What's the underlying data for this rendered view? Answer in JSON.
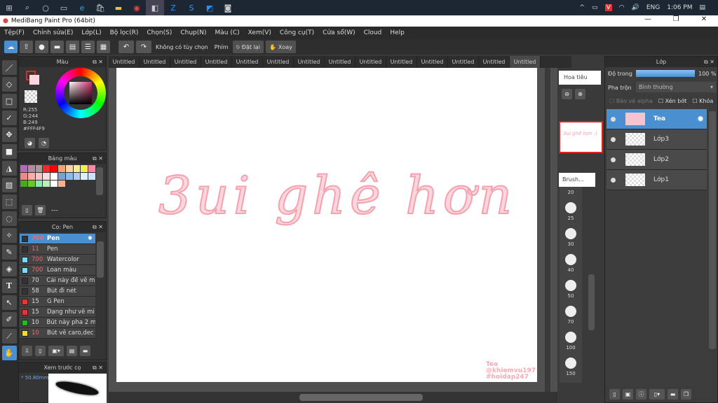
{
  "taskbar": {
    "icons": [
      "windows-icon",
      "search-icon",
      "cortana-icon",
      "task-view-icon",
      "edge-icon",
      "store-icon",
      "explorer-icon",
      "chrome-icon",
      "medibang-icon",
      "zalo-icon",
      "skype-icon",
      "app-icon",
      "camera-icon"
    ],
    "language": "ENG",
    "time": "1:06 PM"
  },
  "window": {
    "title": "MediBang Paint Pro (64bit)"
  },
  "menu": [
    "Tệp(F)",
    "Chỉnh sửa(E)",
    "Lớp(L)",
    "Bộ lọc(R)",
    "Chọn(S)",
    "Chụp(N)",
    "Màu (C)",
    "Xem(V)",
    "Công cụ(T)",
    "Cửa sổ(W)",
    "Cloud",
    "Help"
  ],
  "toolbar": {
    "no_option": "Không có tùy chọn",
    "key_label": "Phím",
    "reset": "Đặt lại",
    "rotate": "Xoay"
  },
  "color_panel": {
    "title": "Màu",
    "r": "R:255",
    "g": "G:244",
    "b": "B:249",
    "hex": "#FFF4F9",
    "primary": "#FFF4F9",
    "secondary": "#FFD6DE"
  },
  "palette_panel": {
    "title": "Bảng màu",
    "name": "---",
    "colors": [
      "#b36bb3",
      "#b38aa0",
      "#aa9999",
      "#ee2a2a",
      "#ff0000",
      "#ffa070",
      "#ffd4a0",
      "#ffee88",
      "#eeee55",
      "#ff88aa",
      "#f08888",
      "#ffaaaa",
      "#ffc0c8",
      "#ffd8e0",
      "#ffffff",
      "#7ea0d0",
      "#88bbee",
      "#aaccff",
      "#ddeeff",
      "#cce0ff",
      "#44aa22",
      "#66cc22",
      "#88eeaa",
      "#bbeebb",
      "#ffffff",
      "#ffb090"
    ]
  },
  "brush_panel": {
    "title": "Cọ: Pen",
    "items": [
      {
        "size": "700",
        "name": "Pen",
        "color": "#333333",
        "red": true,
        "selected": true
      },
      {
        "size": "11",
        "name": "Pen",
        "color": "#333333",
        "red": true
      },
      {
        "size": "700",
        "name": "Watercolor",
        "color": "#77ddff",
        "red": true
      },
      {
        "size": "700",
        "name": "Loan màu",
        "color": "#77ddff",
        "red": true
      },
      {
        "size": "70",
        "name": "Cái này để vẽ mi",
        "color": "#333333"
      },
      {
        "size": "58",
        "name": "Bút đi nét",
        "color": "#333333"
      },
      {
        "size": "15",
        "name": "G Pen",
        "color": "#ee3333"
      },
      {
        "size": "15",
        "name": "Dạng như vẽ mi",
        "color": "#ee3333"
      },
      {
        "size": "10",
        "name": "Bút này pha 2 m",
        "color": "#22bb22"
      },
      {
        "size": "10",
        "name": "Bút vẽ caro,dec",
        "color": "#eedd22",
        "red": true
      }
    ]
  },
  "brush_preview": {
    "title": "Xem trước cọ",
    "size": "* 50.80mm"
  },
  "tabs": [
    "Untitled",
    "Untitled",
    "Untitled",
    "Untitled",
    "Untitled",
    "Untitled",
    "Untitled",
    "Untitled",
    "Untitled",
    "Untitled",
    "Untitled",
    "Untitled",
    "Untitled",
    "Untitled"
  ],
  "canvas": {
    "artwork_text": "3ui ghê hơn :)",
    "signature": [
      "Tea",
      "@khiemvu197",
      "#hoidap247"
    ]
  },
  "navigator": {
    "title": "Hoa tiêu"
  },
  "brush_size": {
    "title": "Brush...",
    "sizes": [
      "20",
      "25",
      "30",
      "40",
      "50",
      "70",
      "100",
      "150"
    ]
  },
  "layer_panel": {
    "title": "Lớp",
    "opacity_label": "Độ trong",
    "opacity_value": "100 %",
    "opacity": 100,
    "blend_label": "Pha trộn",
    "blend_value": "Bình thường",
    "protect_alpha": "Bảo vệ alpha",
    "clip": "Xén bớt",
    "lock": "Khóa",
    "layers": [
      {
        "name": "Tea",
        "selected": true
      },
      {
        "name": "Lớp3"
      },
      {
        "name": "Lớp2"
      },
      {
        "name": "Lớp1"
      }
    ]
  }
}
